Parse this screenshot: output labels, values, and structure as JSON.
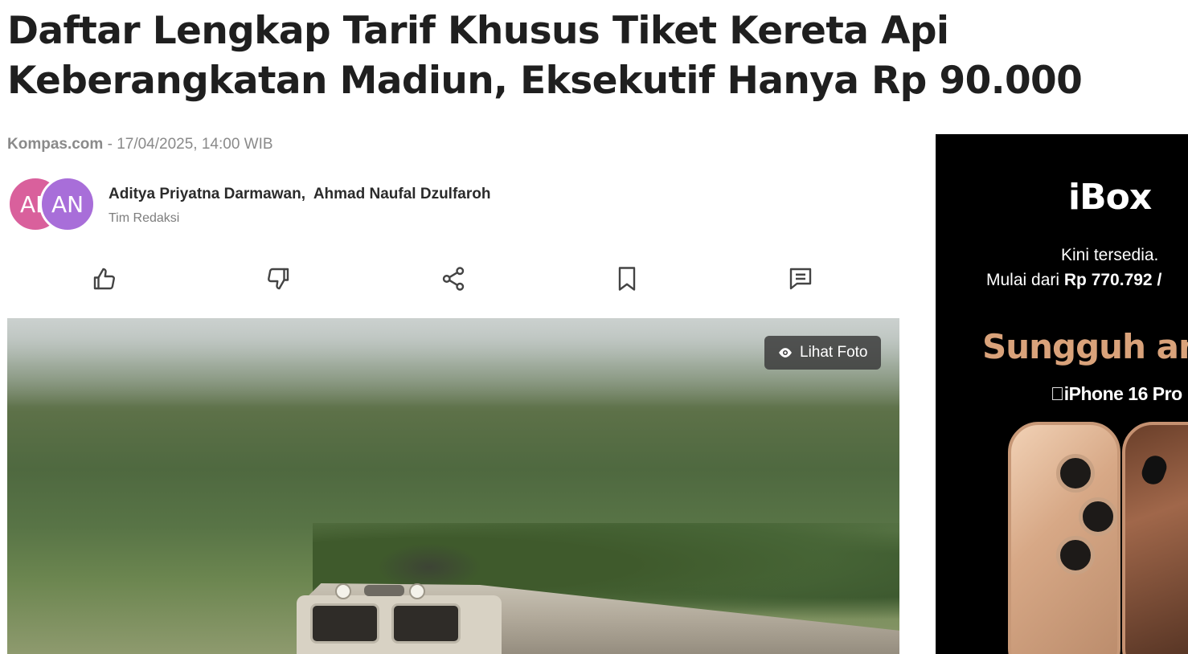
{
  "article": {
    "title": "Daftar Lengkap Tarif Khusus Tiket Kereta Api Keberangkatan Madiun, Eksekutif Hanya Rp 90.000",
    "source": "Kompas.com",
    "separator": " - ",
    "datetime": "17/04/2025, 14:00 WIB"
  },
  "authors": {
    "avatars": [
      "AD",
      "AN"
    ],
    "names": "Aditya Priyatna Darmawan,  Ahmad Naufal Dzulfaroh",
    "team": "Tim Redaksi"
  },
  "actions": [
    {
      "name": "like",
      "icon": "thumbs-up-icon"
    },
    {
      "name": "dislike",
      "icon": "thumbs-down-icon"
    },
    {
      "name": "share",
      "icon": "share-icon"
    },
    {
      "name": "bookmark",
      "icon": "bookmark-icon"
    },
    {
      "name": "comment",
      "icon": "comment-icon"
    }
  ],
  "hero": {
    "view_photo_label": "Lihat Foto",
    "view_photo_icon": "eye-icon"
  },
  "ad": {
    "brand": "iBox",
    "line1": "Kini tersedia.",
    "line2_prefix": "Mulai dari ",
    "line2_price": "Rp 770.792 /",
    "tagline": "Sungguh an",
    "model": "iPhone 16 Pro",
    "model_icon": "apple-icon",
    "colors": {
      "tagline": "#d9a27a",
      "background": "#000000"
    }
  },
  "colors": {
    "title": "#1f1f1f",
    "meta": "#8a8a8a",
    "avatar1": "#d9609c",
    "avatar2": "#a86ed9"
  }
}
